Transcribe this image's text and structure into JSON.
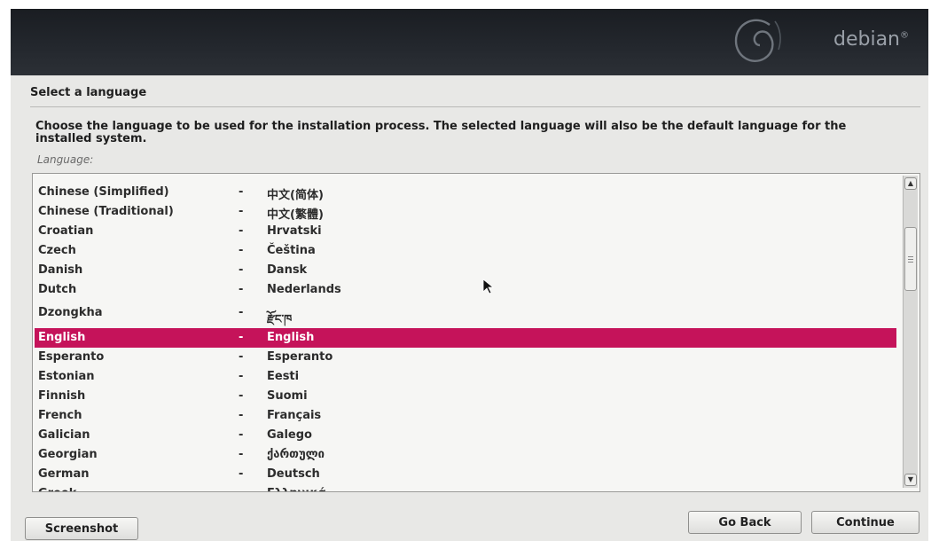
{
  "header": {
    "brand": "debian",
    "brand_mark": "®"
  },
  "dialog": {
    "title": "Select a language",
    "description": "Choose the language to be used for the installation process. The selected language will also be the default language for the installed system.",
    "field_label": "Language:"
  },
  "languages": [
    {
      "name": "Chinese (Simplified)",
      "native": "中文(简体)"
    },
    {
      "name": "Chinese (Traditional)",
      "native": "中文(繁體)"
    },
    {
      "name": "Croatian",
      "native": "Hrvatski"
    },
    {
      "name": "Czech",
      "native": "Čeština"
    },
    {
      "name": "Danish",
      "native": "Dansk"
    },
    {
      "name": "Dutch",
      "native": "Nederlands"
    },
    {
      "name": "Dzongkha",
      "native": "རྫོང་ཁ"
    },
    {
      "name": "English",
      "native": "English",
      "selected": true
    },
    {
      "name": "Esperanto",
      "native": "Esperanto"
    },
    {
      "name": "Estonian",
      "native": "Eesti"
    },
    {
      "name": "Finnish",
      "native": "Suomi"
    },
    {
      "name": "French",
      "native": "Français"
    },
    {
      "name": "Galician",
      "native": "Galego"
    },
    {
      "name": "Georgian",
      "native": "ქართული"
    },
    {
      "name": "German",
      "native": "Deutsch"
    },
    {
      "name": "Greek",
      "native": "Ελληνικά"
    }
  ],
  "separator": "-",
  "buttons": {
    "screenshot": "Screenshot",
    "back": "Go Back",
    "continue": "Continue"
  },
  "colors": {
    "selection": "#c5135a",
    "banner": "#1f2227"
  }
}
